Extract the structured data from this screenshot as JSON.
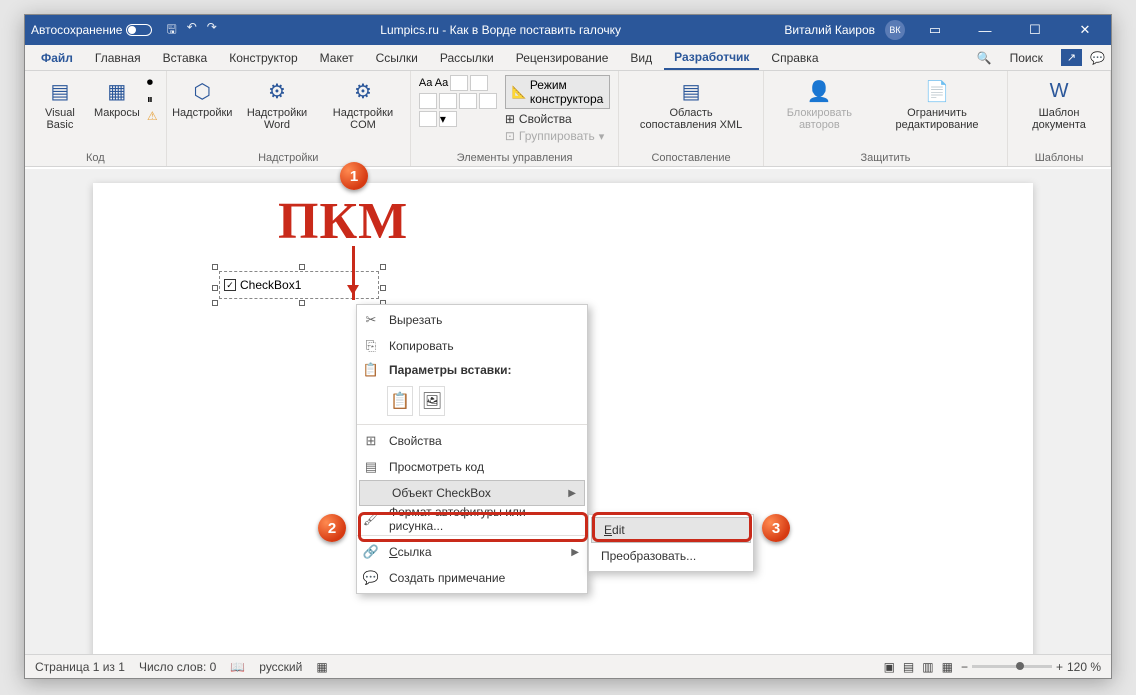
{
  "titlebar": {
    "autosave": "Автосохранение",
    "title": "Lumpics.ru - Как в Ворде поставить галочку",
    "user": "Виталий Каиров",
    "initials": "ВК"
  },
  "tabs": {
    "file": "Файл",
    "home": "Главная",
    "insert": "Вставка",
    "design": "Конструктор",
    "layout": "Макет",
    "references": "Ссылки",
    "mailings": "Рассылки",
    "review": "Рецензирование",
    "view": "Вид",
    "developer": "Разработчик",
    "help": "Справка",
    "search": "Поиск"
  },
  "ribbon": {
    "code": {
      "vb": "Visual Basic",
      "macros": "Макросы",
      "label": "Код"
    },
    "addins": {
      "addins": "Надстройки",
      "word": "Надстройки Word",
      "com": "Надстройки COM",
      "label": "Надстройки"
    },
    "controls": {
      "designmode": "Режим конструктора",
      "props": "Свойства",
      "group": "Группировать",
      "label": "Элементы управления"
    },
    "mapping": {
      "xml": "Область сопоставления XML",
      "label": "Сопоставление"
    },
    "protect": {
      "block": "Блокировать авторов",
      "restrict": "Ограничить редактирование",
      "label": "Защитить"
    },
    "templates": {
      "template": "Шаблон документа",
      "label": "Шаблоны"
    }
  },
  "checkbox": {
    "label": "CheckBox1"
  },
  "contextmenu": {
    "cut": "Вырезать",
    "copy": "Копировать",
    "paste_header": "Параметры вставки:",
    "props": "Свойства",
    "viewcode": "Просмотреть код",
    "object": "Объект CheckBox",
    "format": "Формат автофигуры или рисунка...",
    "link": "Ссылка",
    "comment": "Создать примечание"
  },
  "submenu": {
    "edit": "Edit",
    "convert": "Преобразовать..."
  },
  "statusbar": {
    "page": "Страница 1 из 1",
    "words": "Число слов: 0",
    "lang": "русский",
    "zoom": "120 %"
  },
  "annotation": {
    "pkm": "ПКМ"
  }
}
